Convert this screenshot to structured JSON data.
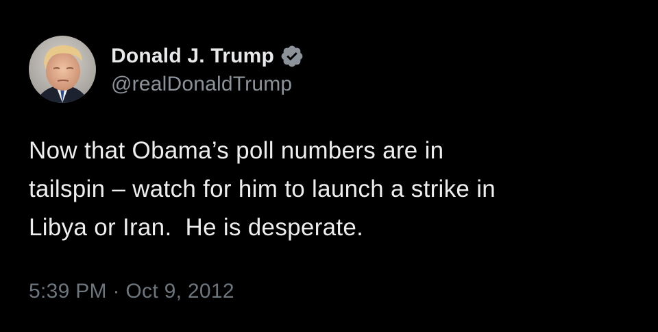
{
  "user": {
    "display_name": "Donald J. Trump",
    "handle": "@realDonaldTrump",
    "verified": true,
    "verified_icon": "verified-badge-icon"
  },
  "tweet": {
    "lines": [
      "Now that Obama’s poll numbers are in",
      "tailspin – watch for him to launch a strike in",
      "Libya or Iran.  He is desperate."
    ],
    "time": "5:39 PM",
    "separator": "·",
    "date": "Oct 9, 2012"
  },
  "colors": {
    "background": "#000000",
    "primary_text": "#e7e9ea",
    "secondary_text": "#6e767d",
    "badge": "#8b9299"
  }
}
